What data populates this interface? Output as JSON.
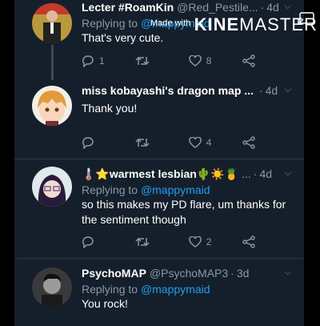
{
  "watermark": {
    "made_with": "Made with",
    "brand_a": "KINE",
    "brand_b": "MASTER"
  },
  "tweets": [
    {
      "display_name": "Lecter #RoamKin",
      "handle": "@Red_Pestile...",
      "time": "4d",
      "replying_to_label": "Replying to",
      "replying_to": "@mappymaid",
      "text": "That's very cute.",
      "replies": "1",
      "retweets": "",
      "likes": "8"
    },
    {
      "display_name": "miss kobayashi's dragon map ...",
      "handle": "",
      "time": "4d",
      "text": "Thank you!",
      "replies": "",
      "retweets": "",
      "likes": "4"
    },
    {
      "display_name": "🌡️⭐warmest lesbian🌵☀️🍍",
      "handle": "...",
      "time": "4d",
      "replying_to_label": "Replying to",
      "replying_to": "@mappymaid",
      "text_line1": "so this makes my PD flare, um thanks for",
      "text_line2": "the sentiment though",
      "replies": "",
      "retweets": "",
      "likes": "2"
    },
    {
      "display_name": "PsychoMAP",
      "handle": "@PsychoMAP3",
      "time": "3d",
      "replying_to_label": "Replying to",
      "replying_to": "@mappymaid",
      "text": "You rock!"
    }
  ],
  "colors": {
    "background": "#151f2b",
    "muted": "#8899a6",
    "accent": "#1da1f2",
    "text": "#ffffff"
  }
}
